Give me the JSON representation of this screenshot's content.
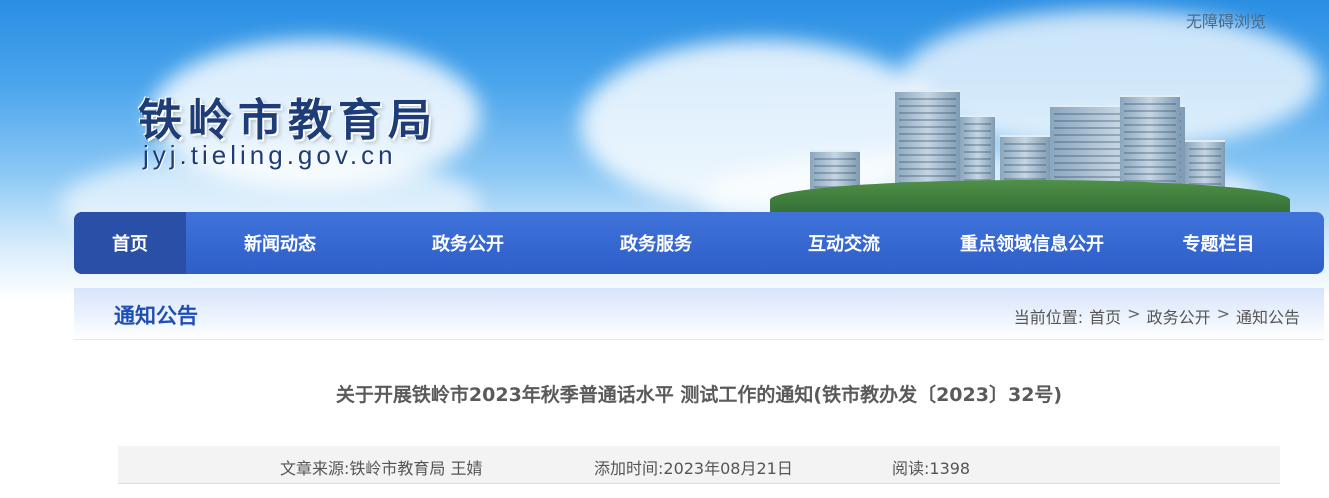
{
  "header": {
    "site_name": "铁岭市教育局",
    "site_url": "jyj.tieling.gov.cn",
    "accessibility_link": "无障碍浏览"
  },
  "nav": {
    "items": [
      {
        "label": "首页",
        "active": true
      },
      {
        "label": "新闻动态"
      },
      {
        "label": "政务公开"
      },
      {
        "label": "政务服务"
      },
      {
        "label": "互动交流"
      },
      {
        "label": "重点领域信息公开"
      },
      {
        "label": "专题栏目"
      }
    ]
  },
  "breadcrumb": {
    "section_title": "通知公告",
    "prefix": "当前位置:",
    "items": [
      "首页",
      "政务公开",
      "通知公告"
    ],
    "separator": ">"
  },
  "article": {
    "title": "关于开展铁岭市2023年秋季普通话水平 测试工作的通知(铁市教办发〔2023〕32号)",
    "source": "文章来源:铁岭市教育局  王婧",
    "added_time": "添加时间:2023年08月21日",
    "reads": "阅读:1398"
  },
  "colors": {
    "nav_bg": "#3f73da",
    "nav_active": "#2a4fa6",
    "section_title": "#1f4fb4",
    "site_name": "#1d3c78"
  }
}
